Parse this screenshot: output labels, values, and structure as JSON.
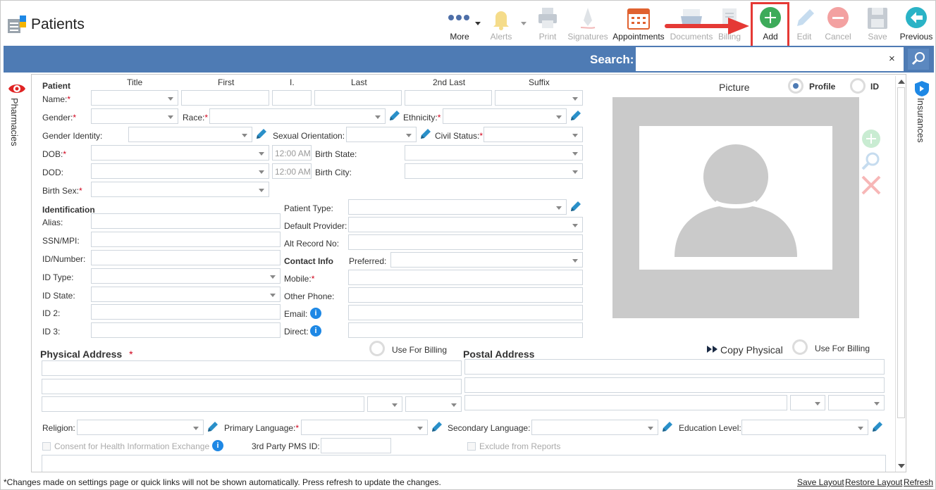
{
  "window": {
    "title": "Patients"
  },
  "toolbar": {
    "more": "More",
    "alerts": "Alerts",
    "print": "Print",
    "signatures": "Signatures",
    "appointments": "Appointments",
    "documents": "Documents",
    "billing": "Billing",
    "add": "Add",
    "edit": "Edit",
    "cancel": "Cancel",
    "save": "Save",
    "previous": "Previous"
  },
  "search": {
    "label": "Search:",
    "value": "",
    "clear": "×"
  },
  "sidetabs": {
    "left": "Pharmacies",
    "right": "Insurances"
  },
  "patient": {
    "section": "Patient",
    "columns": {
      "title": "Title",
      "first": "First",
      "initial": "I.",
      "last": "Last",
      "second_last": "2nd Last",
      "suffix": "Suffix"
    },
    "name": "Name:",
    "gender": "Gender:",
    "race": "Race:",
    "ethnicity": "Ethnicity:",
    "gender_identity": "Gender Identity:",
    "sexual_orientation": "Sexual Orientation:",
    "civil_status": "Civil Status:",
    "dob": "DOB:",
    "dod": "DOD:",
    "time_placeholder": "12:00 AM",
    "birth_state": "Birth State:",
    "birth_city": "Birth City:",
    "birth_sex": "Birth Sex:",
    "required_mark": "*"
  },
  "identification": {
    "section": "Identification",
    "alias": "Alias:",
    "ssn": "SSN/MPI:",
    "id_number": "ID/Number:",
    "id_type": "ID Type:",
    "id_state": "ID State:",
    "id2": "ID 2:",
    "id3": "ID 3:",
    "patient_type": "Patient Type:",
    "default_provider": "Default Provider:",
    "alt_record": "Alt Record No:"
  },
  "contact": {
    "section": "Contact Info",
    "preferred": "Preferred:",
    "mobile": "Mobile:",
    "other_phone": "Other Phone:",
    "email": "Email:",
    "direct": "Direct:",
    "info_glyph": "i"
  },
  "picture": {
    "title": "Picture",
    "profile": "Profile",
    "id": "ID"
  },
  "physical_address": {
    "title": "Physical Address",
    "use_for_billing": "Use For Billing"
  },
  "postal_address": {
    "title": "Postal Address",
    "copy_physical": "Copy Physical",
    "use_for_billing": "Use For Billing"
  },
  "misc": {
    "religion": "Religion:",
    "primary_language": "Primary Language:",
    "secondary_language": "Secondary Language:",
    "education_level": "Education Level:",
    "consent": "Consent for Health Information Exchange",
    "third_party": "3rd Party PMS ID:",
    "exclude": "Exclude from Reports"
  },
  "footer": {
    "note": "*Changes made on settings page or quick links will not be shown automatically. Press refresh to update the changes.",
    "save_layout": "Save Layout",
    "restore_layout": "Restore Layout",
    "refresh": "Refresh"
  },
  "colors": {
    "accent": "#4e7bb4",
    "add_green": "#3dab5a",
    "required": "#d0021b",
    "highlight": "#e53935"
  }
}
